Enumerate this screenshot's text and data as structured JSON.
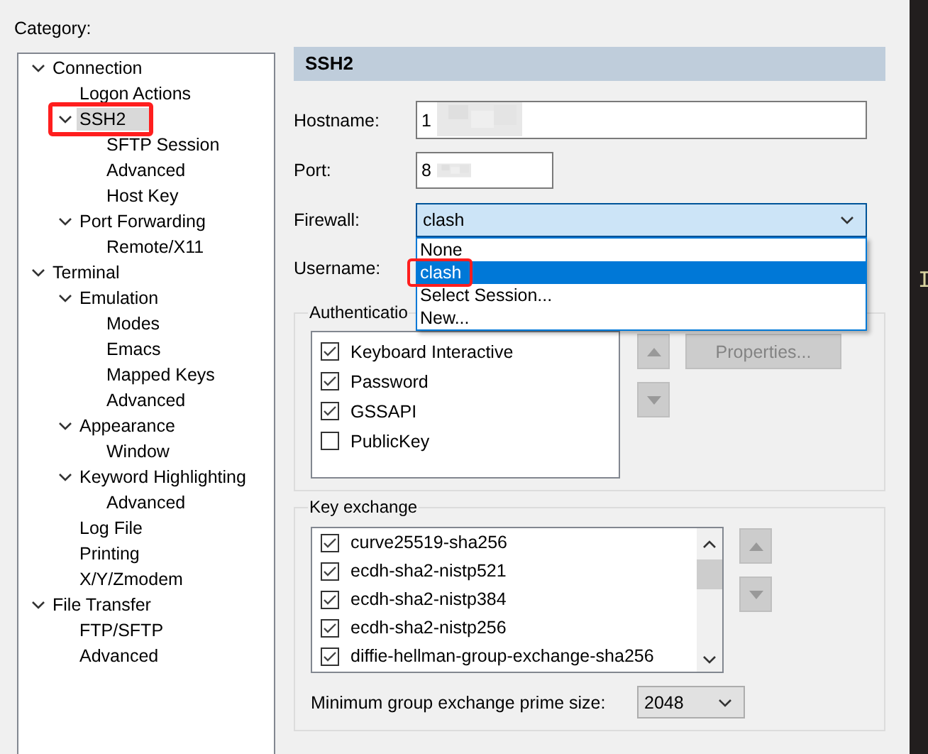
{
  "category_label": "Category:",
  "tree": [
    {
      "label": "Connection",
      "expanded": true,
      "selected": false,
      "children": [
        {
          "label": "Logon Actions",
          "selected": false
        },
        {
          "label": "SSH2",
          "expanded": true,
          "selected": true,
          "annotated": true,
          "children": [
            {
              "label": "SFTP Session",
              "selected": false
            },
            {
              "label": "Advanced",
              "selected": false
            },
            {
              "label": "Host Key",
              "selected": false
            }
          ]
        },
        {
          "label": "Port Forwarding",
          "expanded": true,
          "selected": false,
          "children": [
            {
              "label": "Remote/X11",
              "selected": false
            }
          ]
        }
      ]
    },
    {
      "label": "Terminal",
      "expanded": true,
      "selected": false,
      "children": [
        {
          "label": "Emulation",
          "expanded": true,
          "selected": false,
          "children": [
            {
              "label": "Modes",
              "selected": false
            },
            {
              "label": "Emacs",
              "selected": false
            },
            {
              "label": "Mapped Keys",
              "selected": false
            },
            {
              "label": "Advanced",
              "selected": false
            }
          ]
        },
        {
          "label": "Appearance",
          "expanded": true,
          "selected": false,
          "children": [
            {
              "label": "Window",
              "selected": false
            }
          ]
        },
        {
          "label": "Keyword Highlighting",
          "expanded": true,
          "selected": false,
          "children": [
            {
              "label": "Advanced",
              "selected": false
            }
          ]
        },
        {
          "label": "Log File",
          "selected": false
        },
        {
          "label": "Printing",
          "selected": false
        },
        {
          "label": "X/Y/Zmodem",
          "selected": false
        }
      ]
    },
    {
      "label": "File Transfer",
      "expanded": true,
      "selected": false,
      "children": [
        {
          "label": "FTP/SFTP",
          "selected": false
        },
        {
          "label": "Advanced",
          "selected": false
        }
      ]
    }
  ],
  "panel": {
    "title": "SSH2",
    "hostname": {
      "label": "Hostname:",
      "value": "1",
      "blurred": true
    },
    "port": {
      "label": "Port:",
      "value": "8",
      "blurred": true
    },
    "firewall": {
      "label": "Firewall:",
      "value": "clash",
      "open": true,
      "options": [
        {
          "label": "None",
          "selected": false,
          "annotated": false
        },
        {
          "label": "clash",
          "selected": true,
          "annotated": true
        },
        {
          "label": "Select Session...",
          "selected": false,
          "annotated": false
        },
        {
          "label": "New...",
          "selected": false,
          "annotated": false
        }
      ]
    },
    "username": {
      "label": "Username:"
    },
    "authentication": {
      "title": "Authenticatio",
      "methods": [
        {
          "label": "Keyboard Interactive",
          "checked": true
        },
        {
          "label": "Password",
          "checked": true
        },
        {
          "label": "GSSAPI",
          "checked": true
        },
        {
          "label": "PublicKey",
          "checked": false
        }
      ],
      "properties_button": {
        "label": "Properties...",
        "disabled": true
      }
    },
    "key_exchange": {
      "title": "Key exchange",
      "algorithms": [
        {
          "label": "curve25519-sha256",
          "checked": true
        },
        {
          "label": "ecdh-sha2-nistp521",
          "checked": true
        },
        {
          "label": "ecdh-sha2-nistp384",
          "checked": true
        },
        {
          "label": "ecdh-sha2-nistp256",
          "checked": true
        },
        {
          "label": "diffie-hellman-group-exchange-sha256",
          "checked": true
        }
      ],
      "prime_size": {
        "label": "Minimum group exchange prime size:",
        "value": "2048"
      }
    }
  },
  "terminal_text": "I"
}
